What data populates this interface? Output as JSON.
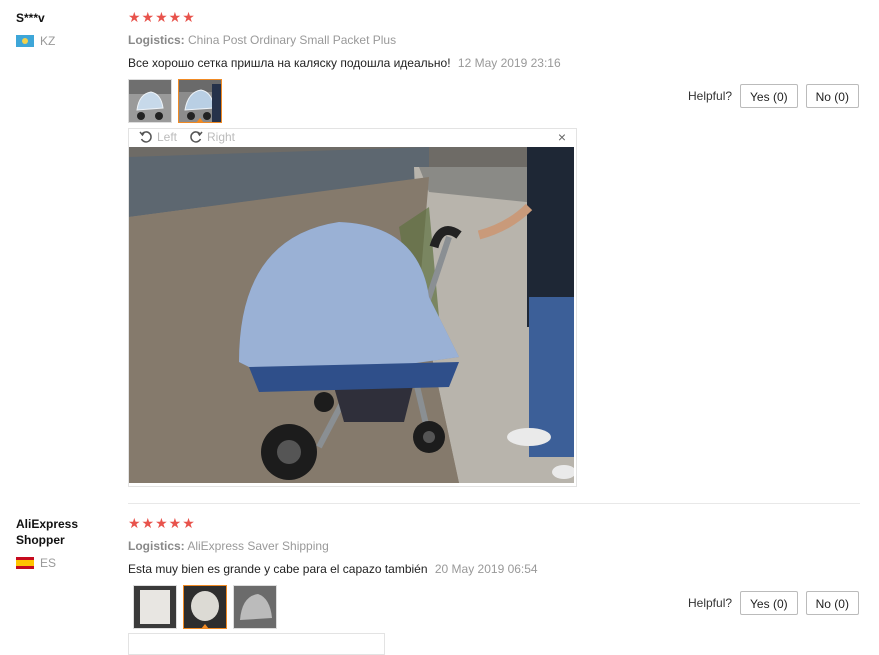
{
  "reviews": [
    {
      "user": "S***v",
      "country_code": "KZ",
      "stars": "★★★★★",
      "logistics_label": "Logistics:",
      "logistics_value": "China Post Ordinary Small Packet Plus",
      "text": "Все хорошо сетка пришла на каляску подошла идеально!",
      "date": "12 May 2019 23:16",
      "helpful_label": "Helpful?",
      "yes_label": "Yes (0)",
      "no_label": "No (0)",
      "viewer": {
        "rotate_left": "Left",
        "rotate_right": "Right",
        "close": "×"
      }
    },
    {
      "user": "AliExpress Shopper",
      "country_code": "ES",
      "stars": "★★★★★",
      "logistics_label": "Logistics:",
      "logistics_value": "AliExpress Saver Shipping",
      "text": "Esta muy bien es grande y cabe para el capazo también",
      "date": "20 May 2019 06:54",
      "helpful_label": "Helpful?",
      "yes_label": "Yes (0)",
      "no_label": "No (0)"
    }
  ],
  "colors": {
    "star": "#e8534c",
    "active_thumb_border": "#f08a24"
  }
}
